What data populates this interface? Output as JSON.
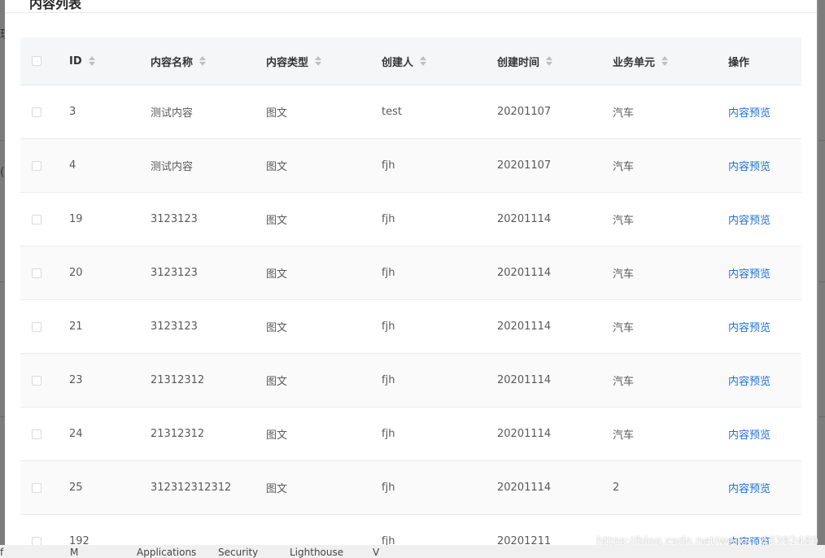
{
  "modal": {
    "title": "内容列表",
    "columns": [
      {
        "label": "ID",
        "sortable": true
      },
      {
        "label": "内容名称",
        "sortable": true
      },
      {
        "label": "内容类型",
        "sortable": true
      },
      {
        "label": "创建人",
        "sortable": true
      },
      {
        "label": "创建时间",
        "sortable": true
      },
      {
        "label": "业务单元",
        "sortable": true
      },
      {
        "label": "操作",
        "sortable": false
      }
    ],
    "rows": [
      {
        "id": "3",
        "name": "测试内容",
        "type": "图文",
        "creator": "test",
        "created": "20201107",
        "unit": "汽车",
        "action": "内容预览"
      },
      {
        "id": "4",
        "name": "测试内容",
        "type": "图文",
        "creator": "fjh",
        "created": "20201107",
        "unit": "汽车",
        "action": "内容预览"
      },
      {
        "id": "19",
        "name": "3123123",
        "type": "图文",
        "creator": "fjh",
        "created": "20201114",
        "unit": "汽车",
        "action": "内容预览"
      },
      {
        "id": "20",
        "name": "3123123",
        "type": "图文",
        "creator": "fjh",
        "created": "20201114",
        "unit": "汽车",
        "action": "内容预览"
      },
      {
        "id": "21",
        "name": "3123123",
        "type": "图文",
        "creator": "fjh",
        "created": "20201114",
        "unit": "汽车",
        "action": "内容预览"
      },
      {
        "id": "23",
        "name": "21312312",
        "type": "图文",
        "creator": "fjh",
        "created": "20201114",
        "unit": "汽车",
        "action": "内容预览"
      },
      {
        "id": "24",
        "name": "21312312",
        "type": "图文",
        "creator": "fjh",
        "created": "20201114",
        "unit": "汽车",
        "action": "内容预览"
      },
      {
        "id": "25",
        "name": "312312312312",
        "type": "图文",
        "creator": "fjh",
        "created": "20201114",
        "unit": "2",
        "action": "内容预览"
      },
      {
        "id": "192",
        "name": "",
        "type": "",
        "creator": "fjh",
        "created": "20201211",
        "unit": "",
        "action": "内容预览"
      }
    ]
  },
  "backdrop": {
    "left_glyphs": [
      "理",
      "("
    ],
    "footer_items": [
      "f",
      "M",
      "Applications",
      "Security",
      "Lighthouse",
      "V"
    ]
  },
  "watermark": "https://blog.csdn.net/weixin_43392489",
  "colors": {
    "link": "#1f6fd6",
    "header_bg": "#f5f6f8",
    "stripe": "#fafafa",
    "overlay": "#8a8a8a"
  }
}
